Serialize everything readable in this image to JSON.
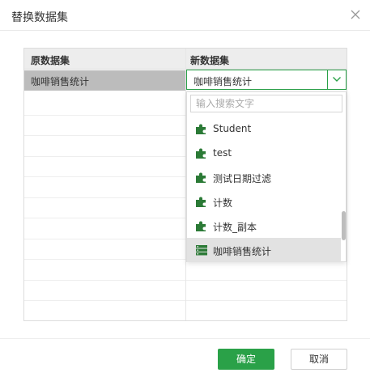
{
  "dialog": {
    "title": "替换数据集",
    "close_icon": "close-icon"
  },
  "table": {
    "headers": {
      "original": "原数据集",
      "new": "新数据集"
    },
    "rows": [
      {
        "original": "咖啡销售统计",
        "new": "咖啡销售统计"
      }
    ]
  },
  "dropdown": {
    "search_placeholder": "输入搜索文字",
    "items": [
      {
        "label": "Student",
        "icon": "puzzle-icon"
      },
      {
        "label": "test",
        "icon": "puzzle-icon"
      },
      {
        "label": "测试日期过滤",
        "icon": "puzzle-icon"
      },
      {
        "label": "计数",
        "icon": "puzzle-icon"
      },
      {
        "label": "计数_副本",
        "icon": "puzzle-icon"
      },
      {
        "label": "咖啡销售统计",
        "icon": "database-icon",
        "selected": true
      }
    ]
  },
  "buttons": {
    "ok": "确定",
    "cancel": "取消"
  },
  "colors": {
    "accent": "#2aa148",
    "icon_green": "#2b7a36",
    "selected_row": "#bcbcbc"
  }
}
